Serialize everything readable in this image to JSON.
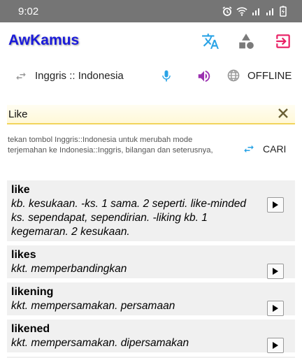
{
  "status": {
    "time": "9:02"
  },
  "app": {
    "title": "AwKamus"
  },
  "colors": {
    "title": "#1a1adb",
    "accent": "#29a3e6",
    "speaker": "#9b2fb0",
    "exit": "#e91e63",
    "field_underline": "#f2d45c"
  },
  "icons": {
    "translate": "translate-icon",
    "shapes": "shapes-icon",
    "exit": "exit-icon",
    "swap": "swap-icon",
    "mic": "mic-icon",
    "speaker": "speaker-icon",
    "globe": "globe-icon",
    "clear": "close-icon",
    "play": "play-icon"
  },
  "lang": {
    "pair": "Inggris :: Indonesia",
    "mode": "OFFLINE"
  },
  "search": {
    "value": "Like",
    "placeholder": ""
  },
  "hint": {
    "text": "tekan tombol Inggris::Indonesia untuk merubah mode terjemahan ke Indonesia::Inggris, bilangan dan seterusnya,"
  },
  "cari": {
    "label": "CARI"
  },
  "results": [
    {
      "word": "like",
      "definition": "kb. kesukaan. -ks. 1 sama. 2 seperti. like-minded ks. sependapat, sependirian. -liking kb. 1 kegemaran. 2 kesukaan."
    },
    {
      "word": "likes",
      "definition": "kkt. memperbandingkan"
    },
    {
      "word": "likening",
      "definition": "kkt. mempersamakan. persamaan"
    },
    {
      "word": "likened",
      "definition": "kkt. mempersamakan. dipersamakan"
    }
  ]
}
